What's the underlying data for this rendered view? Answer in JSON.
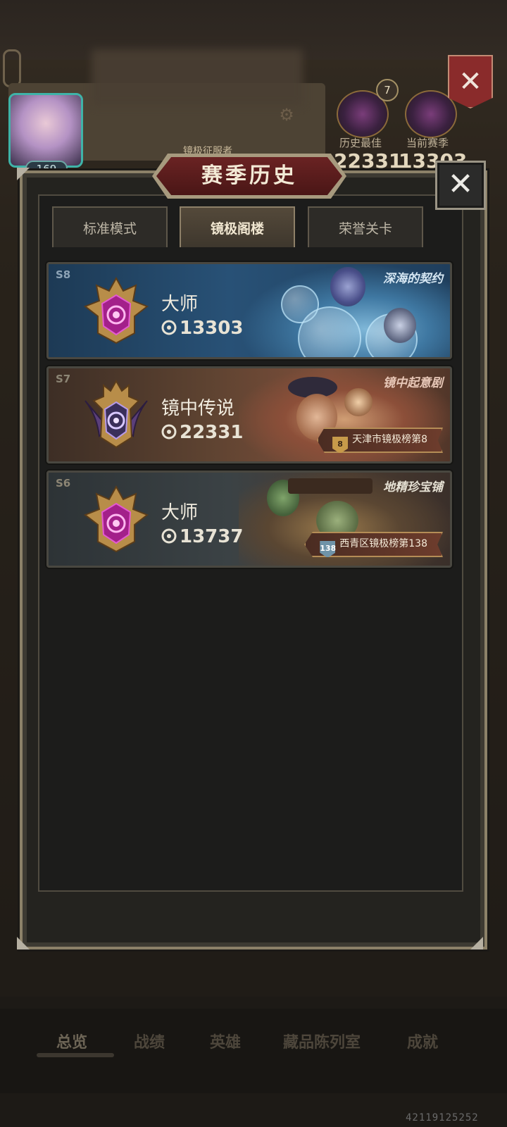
{
  "background": {
    "avatar_level": "169",
    "player_title": "镜极征服者",
    "rank_count": "7",
    "history_best_label": "历史最佳",
    "history_best_value": "22331",
    "current_season_label": "当前赛季",
    "current_season_value": "13303",
    "nav": [
      "总览",
      "战绩",
      "英雄",
      "藏品陈列室",
      "成就"
    ]
  },
  "modal": {
    "title": "赛季历史",
    "close_symbol": "✕",
    "tabs": [
      {
        "label": "标准模式",
        "active": false
      },
      {
        "label": "镜极阁楼",
        "active": true
      },
      {
        "label": "荣誉关卡",
        "active": false
      }
    ],
    "seasons": [
      {
        "tag": "S8",
        "rank": "大师",
        "score": "13303",
        "name": "深海的契约",
        "ranking": ""
      },
      {
        "tag": "S7",
        "rank": "镜中传说",
        "score": "22331",
        "name": "镜中起意剧",
        "ranking_num": "8",
        "ranking": "天津市镜极榜第8"
      },
      {
        "tag": "S6",
        "rank": "大师",
        "score": "13737",
        "name": "地精珍宝铺",
        "ranking_num": "138",
        "ranking": "西青区镜极榜第138"
      }
    ]
  },
  "watermark": "42119125252",
  "colors": {
    "accent_red": "#5b1e1e",
    "tab_active": "#54493a",
    "season8_bg": "#285176",
    "season7_bg": "#5e4331",
    "season6_bg": "#3b4245"
  }
}
